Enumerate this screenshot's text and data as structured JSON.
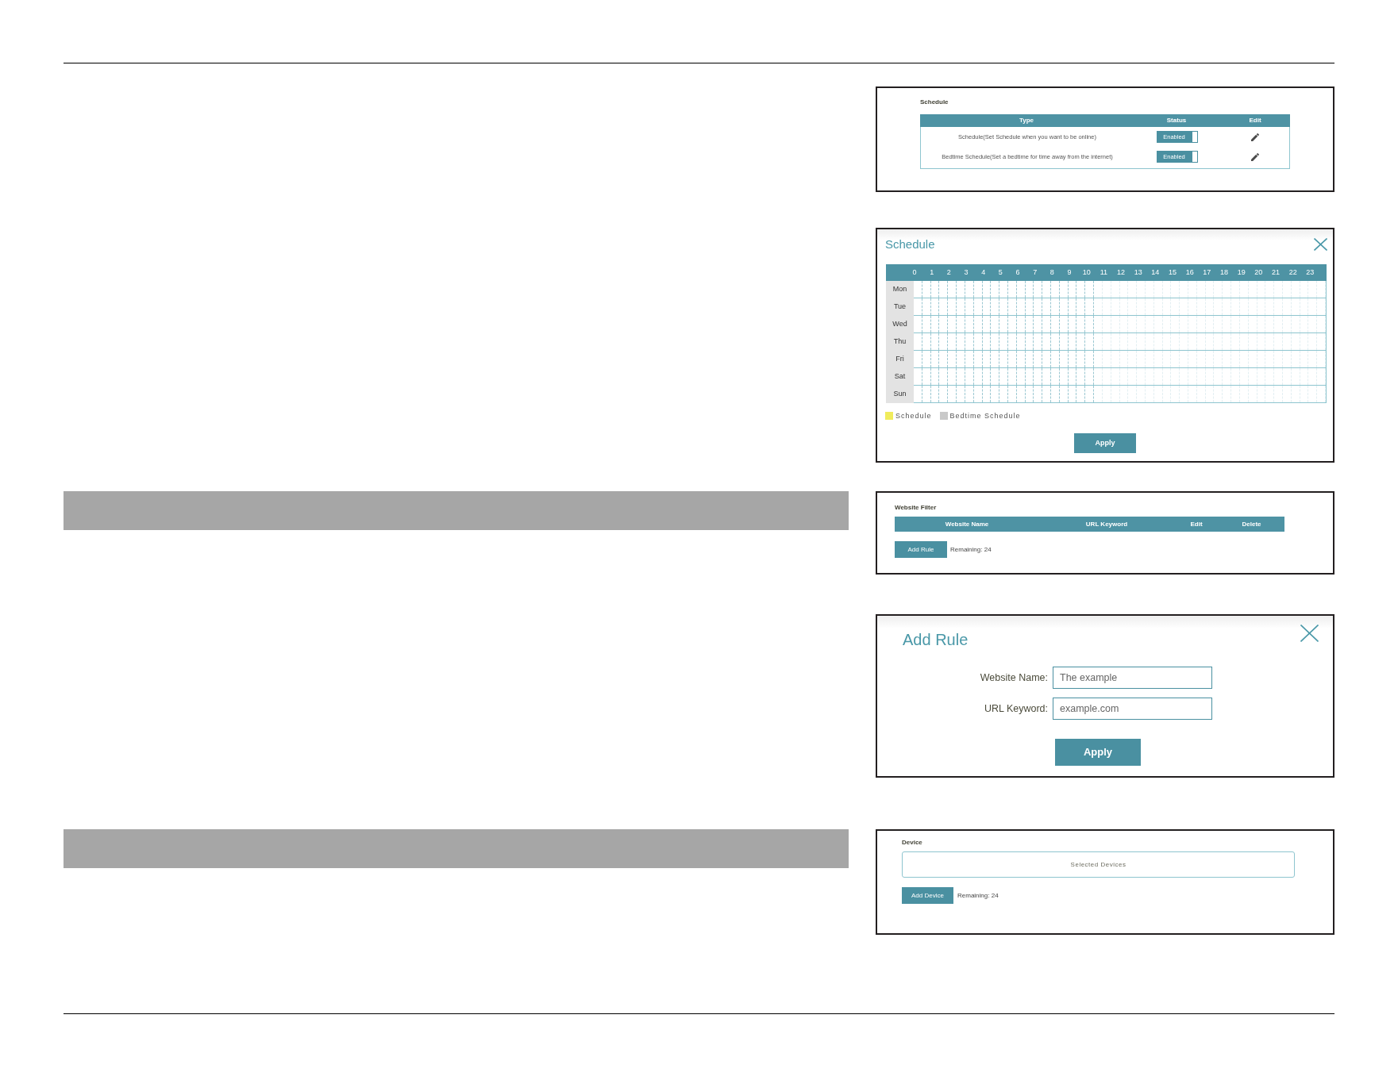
{
  "schedule_panel": {
    "title": "Schedule",
    "columns": [
      "Type",
      "Status",
      "Edit"
    ],
    "rows": [
      {
        "type": "Schedule(Set Schedule when you want to be online)",
        "status": "Enabled",
        "on": true
      },
      {
        "type": "Bedtime Schedule(Set a bedtime for time away from the internet)",
        "status": "Enabled",
        "on": true
      }
    ]
  },
  "schedule_dialog": {
    "title": "Schedule",
    "hours": [
      "0",
      "1",
      "2",
      "3",
      "4",
      "5",
      "6",
      "7",
      "8",
      "9",
      "10",
      "11",
      "12",
      "13",
      "14",
      "15",
      "16",
      "17",
      "18",
      "19",
      "20",
      "21",
      "22",
      "23"
    ],
    "days": [
      "Mon",
      "Tue",
      "Wed",
      "Thu",
      "Fri",
      "Sat",
      "Sun"
    ],
    "legend": [
      {
        "label": "Schedule",
        "color": "#f0ec5c"
      },
      {
        "label": "Bedtime Schedule",
        "color": "#c9c9c9"
      }
    ],
    "button": "Apply"
  },
  "website_filter_panel": {
    "title": "Website Filter",
    "columns": [
      "Website Name",
      "URL Keyword",
      "Edit",
      "Delete"
    ],
    "button": "Add Rule",
    "remaining": "Remaining: 24"
  },
  "add_rule_dialog": {
    "title": "Add Rule",
    "fields": [
      {
        "label": "Website Name:",
        "value": "The example"
      },
      {
        "label": "URL Keyword:",
        "value": "example.com"
      }
    ],
    "button": "Apply"
  },
  "device_panel": {
    "title": "Device",
    "selected_devices": "Selected Devices",
    "button": "Add Device",
    "remaining": "Remaining: 24"
  }
}
